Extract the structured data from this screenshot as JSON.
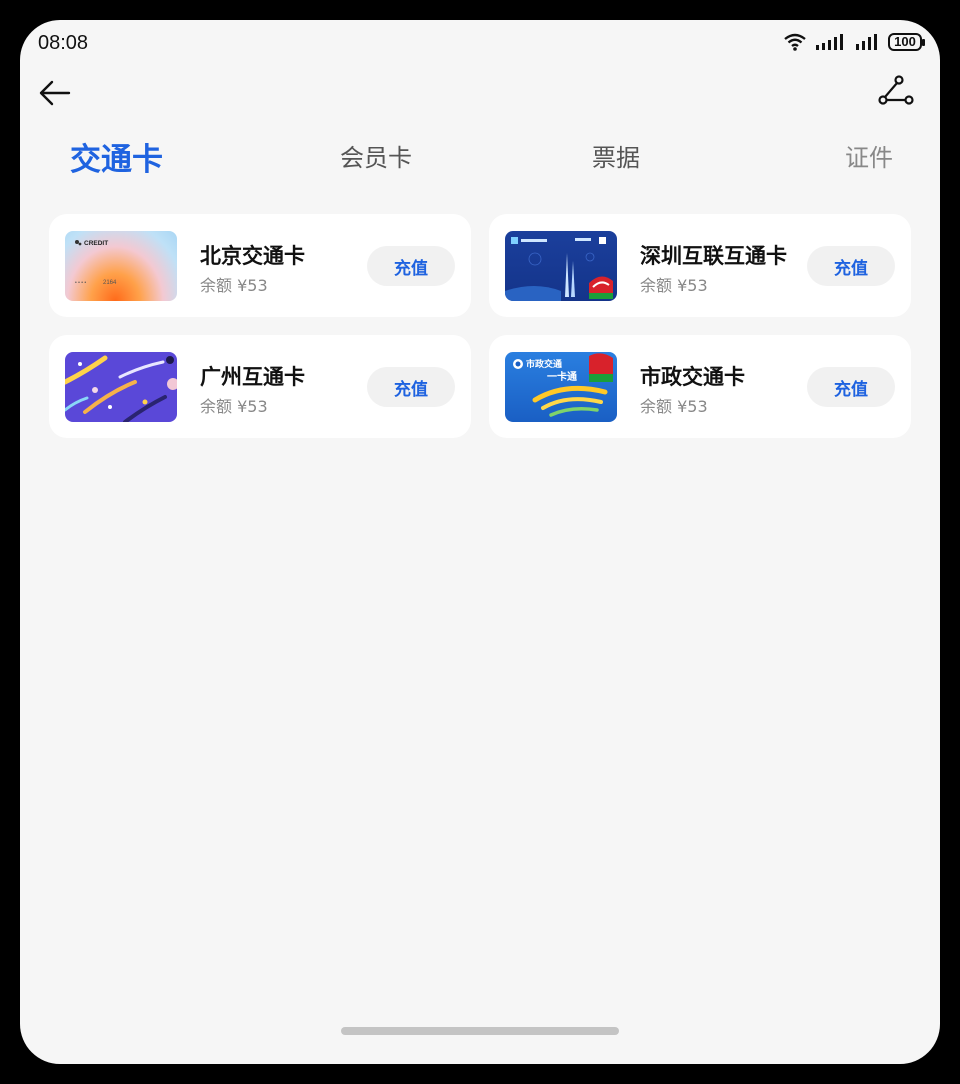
{
  "status_bar": {
    "time": "08:08",
    "battery": "100"
  },
  "tabs": [
    {
      "label": "交通卡",
      "active": true
    },
    {
      "label": "会员卡",
      "active": false
    },
    {
      "label": "票据",
      "active": false
    },
    {
      "label": "证件",
      "active": false
    }
  ],
  "cards": [
    {
      "name": "北京交通卡",
      "balance": "余额 ¥53",
      "button": "充值",
      "art_text": "CREDIT",
      "art_number": "2164"
    },
    {
      "name": "深圳互联互通卡",
      "balance": "余额 ¥53",
      "button": "充值"
    },
    {
      "name": "广州互通卡",
      "balance": "余额 ¥53",
      "button": "充值"
    },
    {
      "name": "市政交通卡",
      "balance": "余额 ¥53",
      "button": "充值",
      "art_text": "市政交通",
      "art_subtext": "一卡通"
    }
  ],
  "colors": {
    "accent": "#1f63e0",
    "background": "#f6f6f6",
    "card": "#ffffff"
  }
}
